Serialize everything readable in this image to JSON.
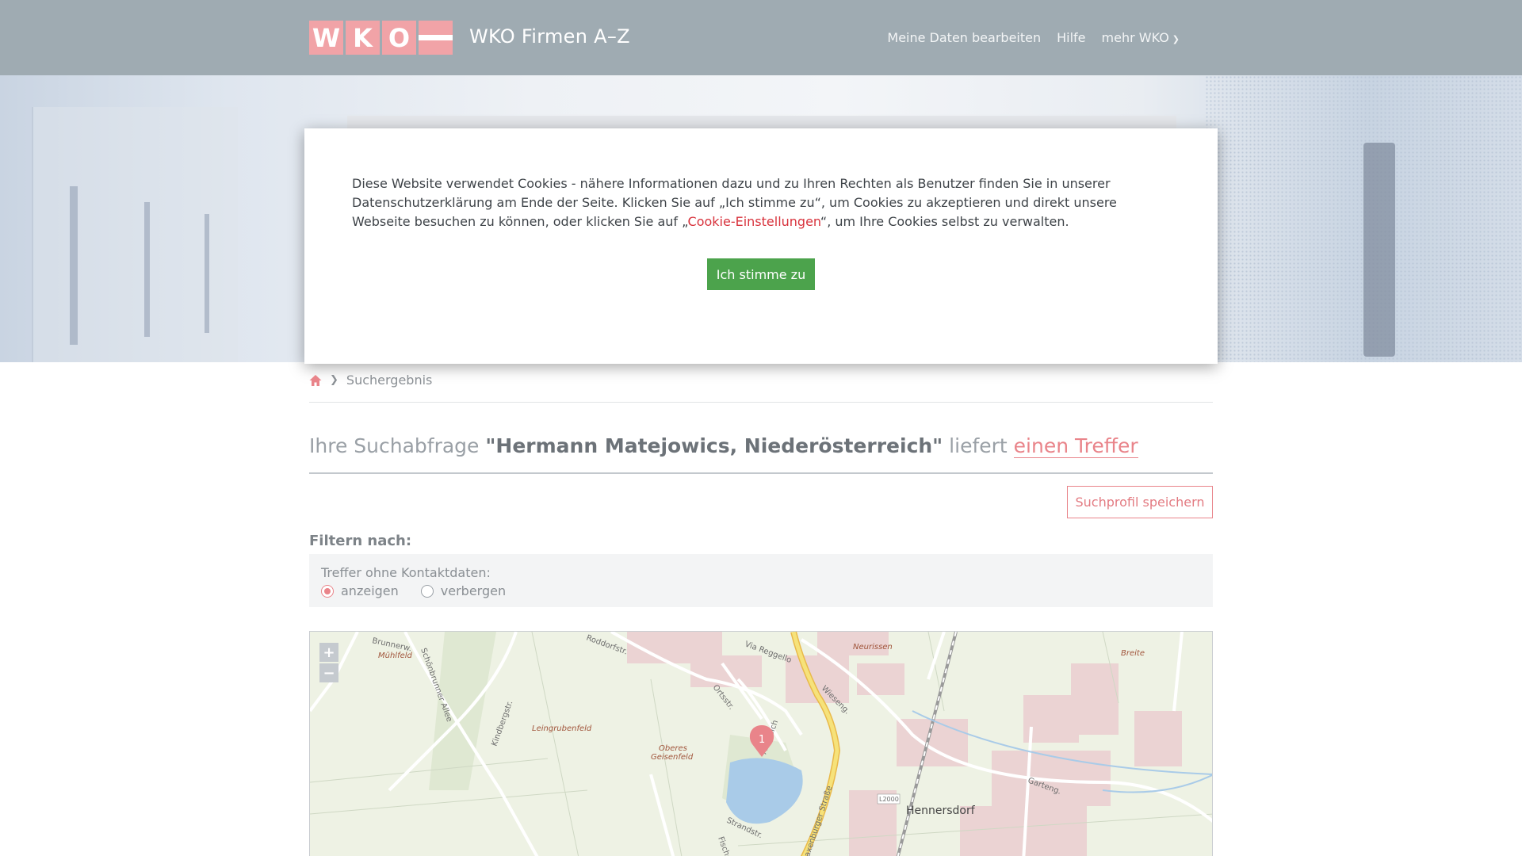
{
  "header": {
    "logo_letters": [
      "W",
      "K",
      "O"
    ],
    "site_title": "WKO Firmen A–Z",
    "nav": {
      "edit_data": "Meine Daten bearbeiten",
      "help": "Hilfe",
      "more": "mehr WKO"
    }
  },
  "cookie_modal": {
    "text_before_link": "Diese Website verwendet Cookies - nähere Informationen dazu und zu Ihren Rechten als Benutzer finden Sie in unserer Datenschutzerklärung am Ende der Seite. Klicken Sie auf „Ich stimme zu“, um Cookies zu akzeptieren und direkt unsere Webseite besuchen zu können, oder klicken Sie auf „",
    "link_text": "Cookie-Einstellungen",
    "text_after_link": "“, um Ihre Cookies selbst zu verwalten.",
    "agree_button": "Ich stimme zu"
  },
  "breadcrumb": {
    "current": "Suchergebnis"
  },
  "result": {
    "prefix": "Ihre Suchabfrage",
    "query": "\"Hermann Matejowics, Niederösterreich\"",
    "middle": "liefert",
    "hits": "einen Treffer"
  },
  "save_profile_button": "Suchprofil speichern",
  "filter": {
    "heading": "Filtern nach:",
    "label": "Treffer ohne Kontaktdaten:",
    "options": [
      "anzeigen",
      "verbergen"
    ],
    "selected": "anzeigen"
  },
  "map": {
    "zoom_in": "+",
    "zoom_out": "−",
    "marker_label": "1",
    "labels": {
      "brunnerw": "Brunnerw.",
      "muehlfeld": "Mühlfeld",
      "roedorfstr": "Roddorfstr.",
      "schoenbrunner": "Schönbrunner Allee",
      "kindbergstr": "Kindbergstr.",
      "leingrubenfeld": "Leingrubenfeld",
      "oberes": "Oberes",
      "geisenfeld": "Geisenfeld",
      "ortsstr": "Ortsstr.",
      "via_reggello": "Via Reggello",
      "wieseng": "Wieseng.",
      "am_teich": "Am Teich",
      "neurissen": "Neurissen",
      "breite": "Breite",
      "laxenburger": "Laxenburger Straße",
      "l2000": "L2000",
      "hennersdorf": "Hennersdorf",
      "gartenweg": "Garteng.",
      "strandstr": "Strandstr.",
      "fischer": "Fischer"
    }
  },
  "colors": {
    "header_bg": "#9fabb2",
    "accent_red": "#e9848a",
    "agree_green": "#4ca34c",
    "link_red": "#d8323c"
  }
}
